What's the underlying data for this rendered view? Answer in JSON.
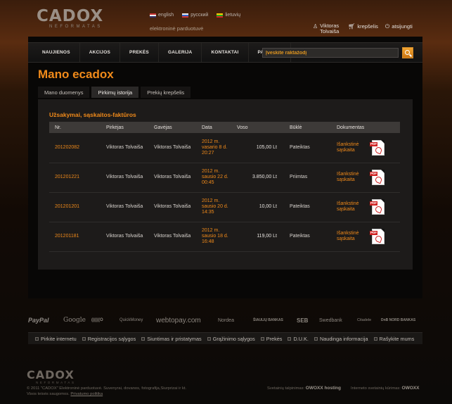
{
  "header": {
    "logo_main": "CADOX",
    "logo_sub": "NEFORMATAS",
    "languages": [
      {
        "label": "english",
        "flag": "flag-en"
      },
      {
        "label": "русский",
        "flag": "flag-ru"
      },
      {
        "label": "lietuvių",
        "flag": "flag-lt"
      }
    ],
    "tagline": "elektroninė parduotuvė",
    "user_name": "Viktoras Tolvaiša",
    "cart_label": "krepšelis",
    "logout_label": "atsijungti"
  },
  "nav": {
    "items": [
      "NAUJIENOS",
      "AKCIJOS",
      "PREKĖS",
      "GALERIJA",
      "KONTAKTAI",
      "PAGALBA"
    ],
    "search_placeholder": "Įveskite raktažodį"
  },
  "page": {
    "title": "Mano ecadox",
    "tabs": [
      {
        "label": "Mano duomenys",
        "active": false
      },
      {
        "label": "Pirkimų istorija",
        "active": true
      },
      {
        "label": "Prekių krepšelis",
        "active": false
      }
    ],
    "panel_title": "Užsakymai, sąskaitos-faktūros"
  },
  "orders": {
    "columns": [
      "Nr.",
      "Pirkėjas",
      "Gavėjas",
      "Data",
      "Voso",
      "Būklė",
      "Dokumentas"
    ],
    "rows": [
      {
        "nr": "201202082",
        "buyer": "Viktoras Tolvaiša",
        "receiver": "Viktoras Tolvaiša",
        "date": "2012 m. vasario 8 d. 20:27",
        "sum": "105,00 Lt",
        "status": "Pateiktas",
        "doc": "Išankstinė sąskaita"
      },
      {
        "nr": "201201221",
        "buyer": "Viktoras Tolvaiša",
        "receiver": "Viktoras Tolvaiša",
        "date": "2012 m. sausio 22 d. 00:45",
        "sum": "3.850,00 Lt",
        "status": "Priimtas",
        "doc": "Išankstinė sąskaita"
      },
      {
        "nr": "201201201",
        "buyer": "Viktoras Tolvaiša",
        "receiver": "Viktoras Tolvaiša",
        "date": "2012 m. sausio 20 d. 14:35",
        "sum": "10,00 Lt",
        "status": "Pateiktas",
        "doc": "Išankstinė sąskaita"
      },
      {
        "nr": "201201181",
        "buyer": "Viktoras Tolvaiša",
        "receiver": "Viktoras Tolvaiša",
        "date": "2012 m. sausio 18 d. 16:48",
        "sum": "119,00 Lt",
        "status": "Pateiktas",
        "doc": "Išankstinė sąskaita"
      }
    ],
    "pdf_tag": "PDF"
  },
  "partners": [
    "PayPal",
    "Google",
    "((((((O",
    "QuickMoney",
    "webtopay.com",
    "Nordea",
    "ŠIAULIŲ BANKAS",
    "SEB",
    "Swedbank",
    "Citadele",
    "DnB NORD BANKAS"
  ],
  "footer_nav": [
    "Pirkite internetu",
    "Registracijos sąlygos",
    "Siuntimas ir pristatymas",
    "Grąžinimo sąlygos",
    "Prekės",
    "D.U.K.",
    "Naudinga informacija",
    "Rašykite mums"
  ],
  "footer": {
    "logo_main": "CADOX",
    "logo_sub": "NEFORMATAS",
    "copyright": "© 2011 \"CADOX\" Elektroninė parduotuvė. Suvenyrai, dovanos, fotografija,Siurprizai ir kt.",
    "rights": "Visos teisės saugomos.",
    "privacy": "Privatumo politika",
    "hosting_label": "Svetainių talpinimas:",
    "hosting_brand": "OWOXX hosting",
    "dev_label": "Interneto svetainių kūrimas:",
    "dev_brand": "OWOXX"
  }
}
